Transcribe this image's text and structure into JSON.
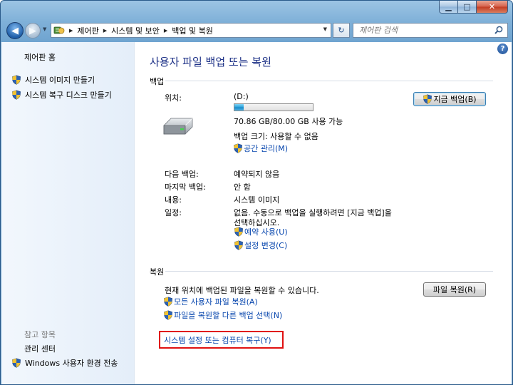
{
  "window": {
    "minimize_glyph": "▁",
    "maximize_glyph": "□",
    "close_glyph": "✕"
  },
  "nav": {
    "back_glyph": "◀",
    "forward_glyph": "▶",
    "crumb_sep": "▶",
    "breadcrumbs": [
      "제어판",
      "시스템 및 보안",
      "백업 및 복원"
    ],
    "refresh_glyph": "↻",
    "search_placeholder": "제어판 검색"
  },
  "sidebar": {
    "home": "제어판 홈",
    "links": [
      "시스템 이미지 만들기",
      "시스템 복구 디스크 만들기"
    ],
    "see_also_heading": "참고 항목",
    "see_also": [
      "관리 센터",
      "Windows 사용자 환경 전송"
    ]
  },
  "help_glyph": "?",
  "main": {
    "title": "사용자 파일 백업 또는 복원",
    "backup": {
      "heading": "백업",
      "location_label": "위치:",
      "location_value": "(D:)",
      "used_fraction": 0.114,
      "space_text": "70.86 GB/80.00 GB 사용 가능",
      "size_text": "백업 크기: 사용할 수 없음",
      "manage_space_link": "공간 관리(M)",
      "backup_now_button": "지금 백업(B)",
      "rows": [
        {
          "label": "다음 백업:",
          "value": "예약되지 않음"
        },
        {
          "label": "마지막 백업:",
          "value": "안 함"
        },
        {
          "label": "내용:",
          "value": "시스템 이미지"
        },
        {
          "label": "일정:",
          "value": "없음. 수동으로 백업을 실행하려면 [지금 백업]을"
        }
      ],
      "schedule_line2": "선택하십시오.",
      "turn_on_schedule_link": "예약 사용(U)",
      "change_settings_link": "설정 변경(C)"
    },
    "restore": {
      "heading": "복원",
      "description": "현재 위치에 백업된 파일을 복원할 수 있습니다.",
      "restore_files_button": "파일 복원(R)",
      "restore_all_users_link": "모든 사용자 파일 복원(A)",
      "select_other_backup_link": "파일을 복원할 다른 백업 선택(N)",
      "recover_system_link": "시스템 설정 또는 컴퓨터 복구(Y)"
    }
  }
}
